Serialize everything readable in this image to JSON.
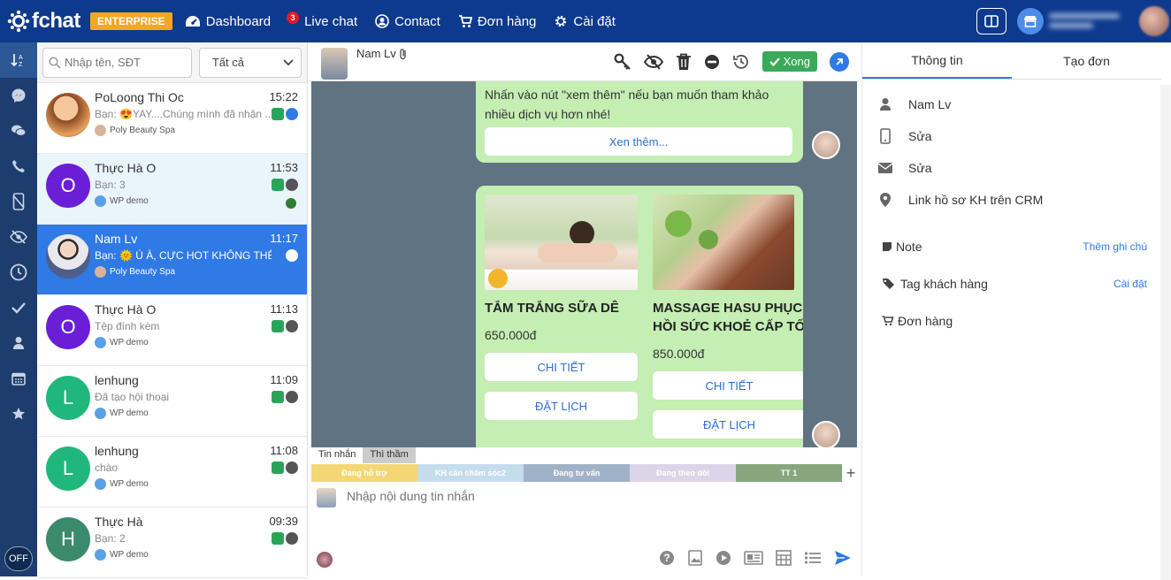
{
  "topbar": {
    "logo_text": "fchat",
    "plan_badge": "ENTERPRISE",
    "nav": [
      {
        "label": "Dashboard",
        "icon": "dashboard-icon"
      },
      {
        "label": "Live chat",
        "icon": "chat-icon",
        "badge": "3"
      },
      {
        "label": "Contact",
        "icon": "contact-icon"
      },
      {
        "label": "Đơn hàng",
        "icon": "cart-icon"
      },
      {
        "label": "Cài đặt",
        "icon": "gear-icon"
      }
    ]
  },
  "search": {
    "placeholder": "Nhập tên, SĐT"
  },
  "filter": {
    "selected": "Tất cả"
  },
  "conversations": [
    {
      "name": "PoLoong Thi Oc",
      "time": "15:22",
      "preview": "Bạn: 😍YAY....Chúng mình đã nhận ...",
      "page": "Poly Beauty Spa",
      "avatar": "",
      "avatar_color": "#c77b4f"
    },
    {
      "name": "Thực Hà O",
      "time": "11:53",
      "preview": "Bạn: 3",
      "page": "WP demo",
      "avatar": "O",
      "avatar_color": "#6a1fd6"
    },
    {
      "name": "Nam Lv",
      "time": "11:17",
      "preview": "Bạn: 🌞 Ú À, CỰC HOT KHÔNG THỂ...",
      "page": "Poly Beauty Spa",
      "avatar": "",
      "avatar_color": "#dfe6ee"
    },
    {
      "name": "Thực Hà O",
      "time": "11:13",
      "preview": "Tệp đính kèm",
      "page": "WP demo",
      "avatar": "O",
      "avatar_color": "#6a1fd6"
    },
    {
      "name": "lenhung",
      "time": "11:09",
      "preview": "Đã tạo hội thoại",
      "page": "WP demo",
      "avatar": "L",
      "avatar_color": "#1fb87a"
    },
    {
      "name": "lenhung",
      "time": "11:08",
      "preview": "chào",
      "page": "WP demo",
      "avatar": "L",
      "avatar_color": "#1fb87a"
    },
    {
      "name": "Thực Hà",
      "time": "09:39",
      "preview": "Bạn: 2",
      "page": "WP demo",
      "avatar": "H",
      "avatar_color": "#3b8a6e"
    }
  ],
  "chat": {
    "contact_name": "Nam Lv",
    "done_label": "Xong",
    "message1": "Nhấn vào nút \"xem thêm\" nếu bạn muốn tham khảo nhiều dịch vụ hơn nhé!",
    "see_more": "Xen thêm...",
    "cards": [
      {
        "title": "TẮM TRẮNG SỮA DÊ",
        "title2": "",
        "price": "650.000đ",
        "btn1": "CHI TIẾT",
        "btn2": "ĐẶT LỊCH"
      },
      {
        "title": "MASSAGE HASU PHỤC",
        "title2": "HỒI SỨC KHOẺ CẤP TỐ",
        "price": "850.000đ",
        "btn1": "CHI TIẾT",
        "btn2": "ĐẶT LỊCH"
      }
    ],
    "tabs": [
      "Tin nhắn",
      "Thì thầm"
    ],
    "tags": [
      {
        "label": "Đang hỗ trợ",
        "color": "#f3d774"
      },
      {
        "label": "KH cần chăm sóc2",
        "color": "#c5dced"
      },
      {
        "label": "Đang tư vấn",
        "color": "#a0b2c8"
      },
      {
        "label": "Đang theo dõi",
        "color": "#dcd4e8"
      },
      {
        "label": "TT 1",
        "color": "#86a77e"
      }
    ],
    "composer_placeholder": "Nhập nội dung tin nhắn"
  },
  "right_panel": {
    "tabs": [
      "Thông tin",
      "Tạo đơn"
    ],
    "info": [
      {
        "icon": "user-icon",
        "value": "Nam Lv"
      },
      {
        "icon": "phone-icon",
        "value": "Sửa"
      },
      {
        "icon": "email-icon",
        "value": "Sửa"
      },
      {
        "icon": "location-icon",
        "value": "Link hồ sơ KH trên CRM"
      }
    ],
    "note_label": "Note",
    "note_action": "Thêm ghi chú",
    "tag_label": "Tag khách hàng",
    "tag_action": "Cài đặt",
    "order_label": "Đơn hàng"
  },
  "rail": {
    "off_label": "OFF"
  }
}
